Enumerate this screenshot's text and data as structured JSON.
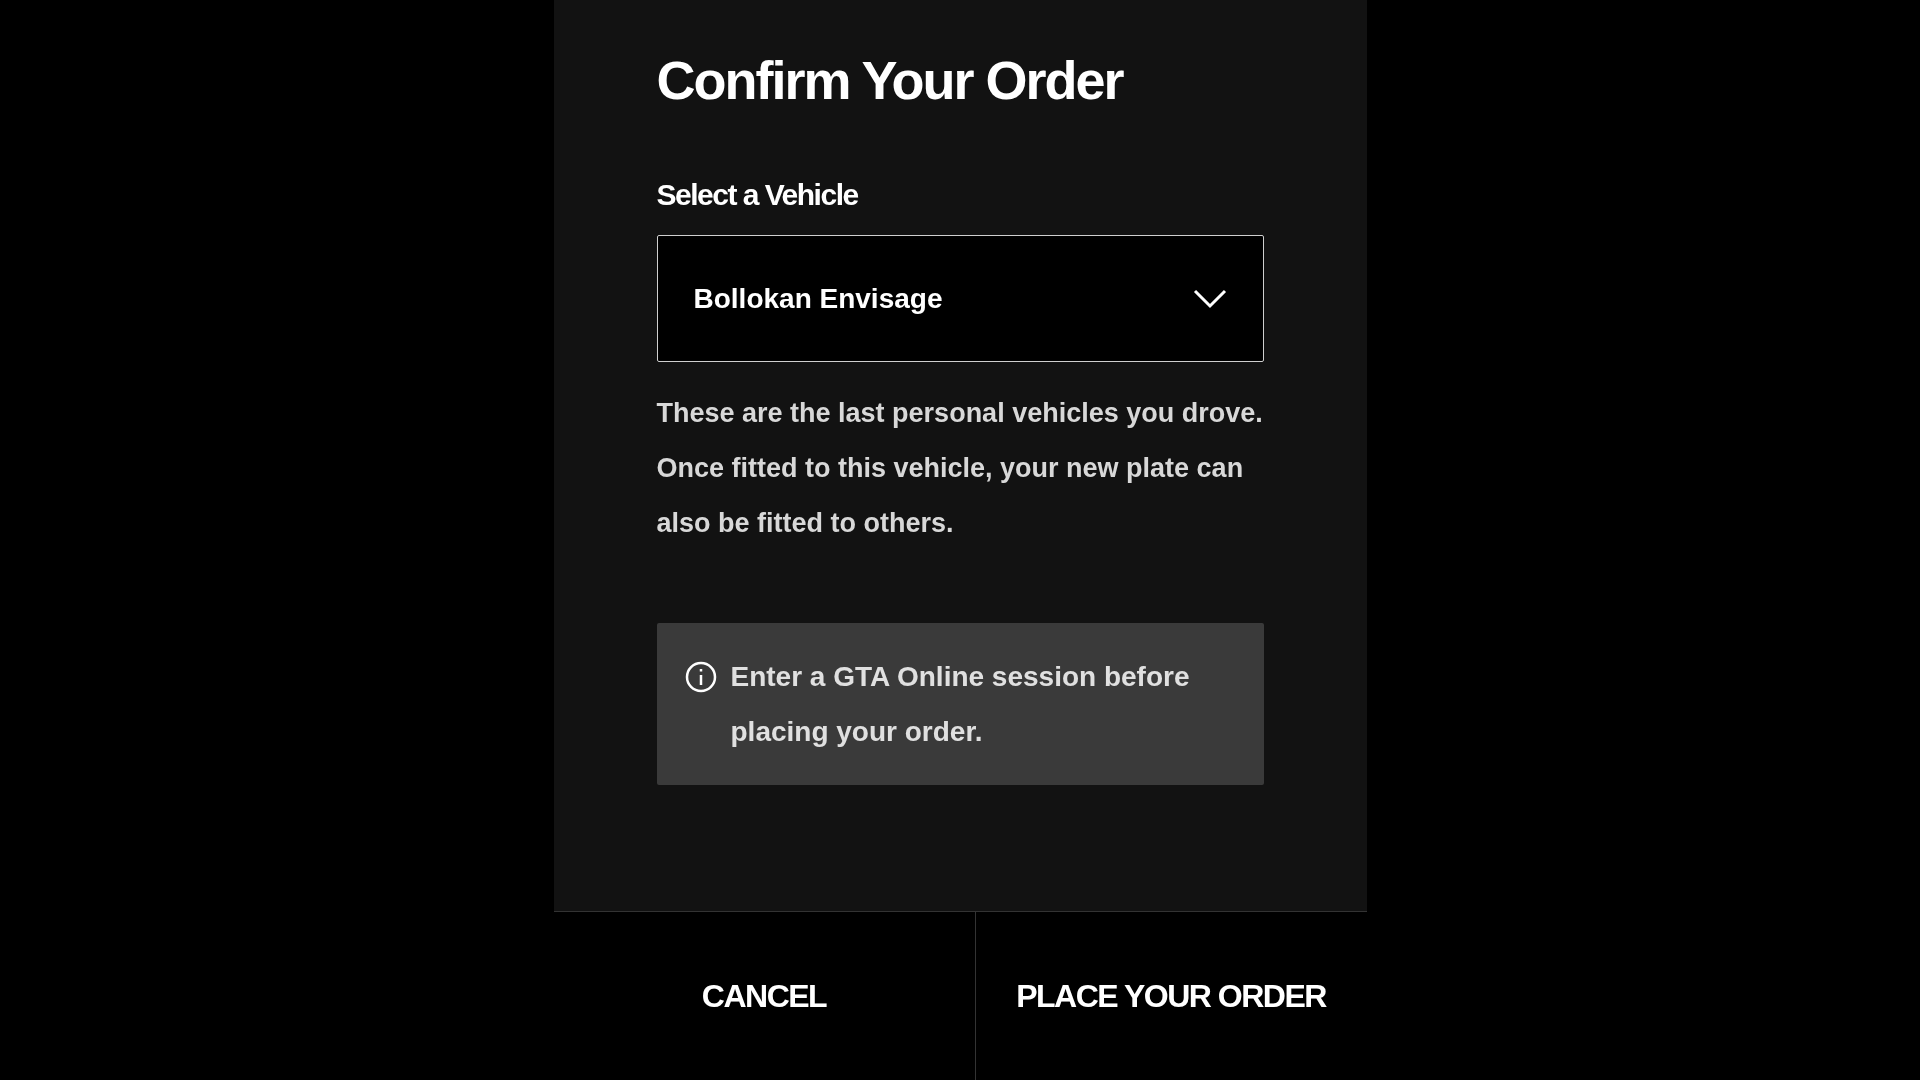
{
  "dialog": {
    "title": "Confirm Your Order",
    "vehicle_select": {
      "label": "Select a Vehicle",
      "value": "Bollokan Envisage"
    },
    "description": "These are the last personal vehicles you drove. Once fitted to this vehicle, your new plate can also be fitted to others.",
    "notice": "Enter a GTA Online session before placing your order.",
    "buttons": [
      {
        "label": "CANCEL"
      },
      {
        "label": "PLACE YOUR ORDER"
      }
    ]
  }
}
